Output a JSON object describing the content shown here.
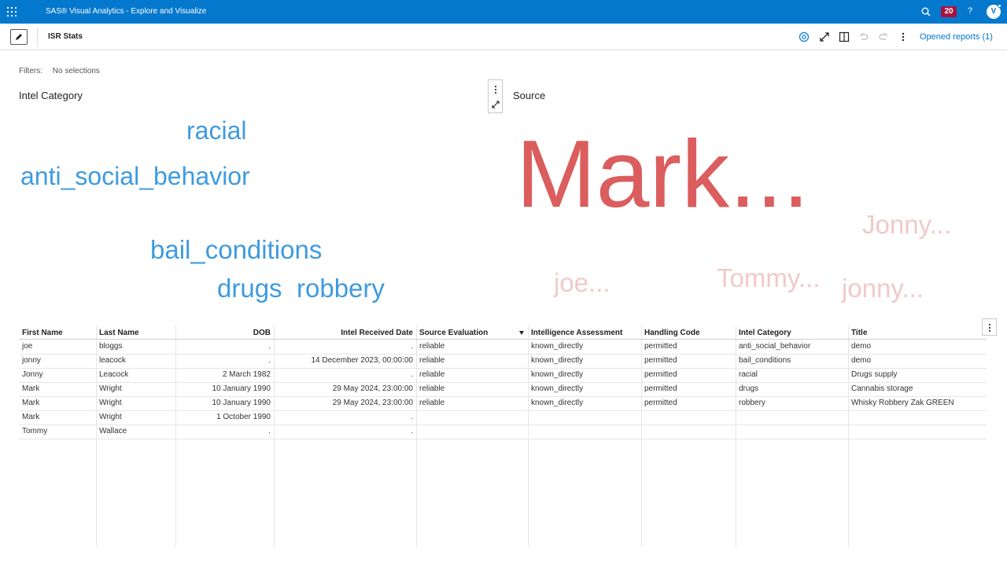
{
  "app": {
    "title": "SAS® Visual Analytics - Explore and Visualize",
    "notification_count": "20",
    "help_label": "?",
    "user_initial": "V"
  },
  "toolbar": {
    "report_title": "ISR Stats",
    "opened_reports": "Opened reports (1)"
  },
  "filters": {
    "label": "Filters:",
    "value": "No selections"
  },
  "left_cloud": {
    "title": "Intel Category",
    "words": [
      "racial",
      "anti_social_behavior",
      "bail_conditions",
      "drugs",
      "robbery"
    ]
  },
  "right_cloud": {
    "title": "Source",
    "words": [
      "Mark...",
      "Jonny...",
      "joe...",
      "Tommy...",
      "jonny..."
    ]
  },
  "colors": {
    "appbar": "#0378cd",
    "badge": "#a8123e",
    "left_words": "#3e9be0",
    "right_main": "#db5d5d",
    "right_minor": "#f1c9c9",
    "link": "#0378cd"
  },
  "table": {
    "columns": [
      "First Name",
      "Last Name",
      "DOB",
      "Intel Received Date",
      "Source Evaluation",
      "Intelligence Assessment",
      "Handling Code",
      "Intel Category",
      "Title"
    ],
    "rows": [
      [
        "joe",
        "bloggs",
        ".",
        ".",
        "reliable",
        "known_directly",
        "permitted",
        "anti_social_behavior",
        "demo"
      ],
      [
        "jonny",
        "leacock",
        ".",
        "14 December 2023, 00:00:00",
        "reliable",
        "known_directly",
        "permitted",
        "bail_conditions",
        "demo"
      ],
      [
        "Jonny",
        "Leacock",
        "2 March 1982",
        ".",
        "reliable",
        "known_directly",
        "permitted",
        "racial",
        "Drugs supply"
      ],
      [
        "Mark",
        "Wright",
        "10 January 1990",
        "29 May 2024, 23:00:00",
        "reliable",
        "known_directly",
        "permitted",
        "drugs",
        "Cannabis storage"
      ],
      [
        "Mark",
        "Wright",
        "10 January 1990",
        "29 May 2024, 23:00:00",
        "reliable",
        "known_directly",
        "permitted",
        "robbery",
        "Whisky Robbery Zak GREEN"
      ],
      [
        "Mark",
        "Wright",
        "1 October 1990",
        ".",
        "",
        "",
        "",
        "",
        ""
      ],
      [
        "Tommy",
        "Wallace",
        ".",
        ".",
        "",
        "",
        "",
        "",
        ""
      ]
    ]
  }
}
